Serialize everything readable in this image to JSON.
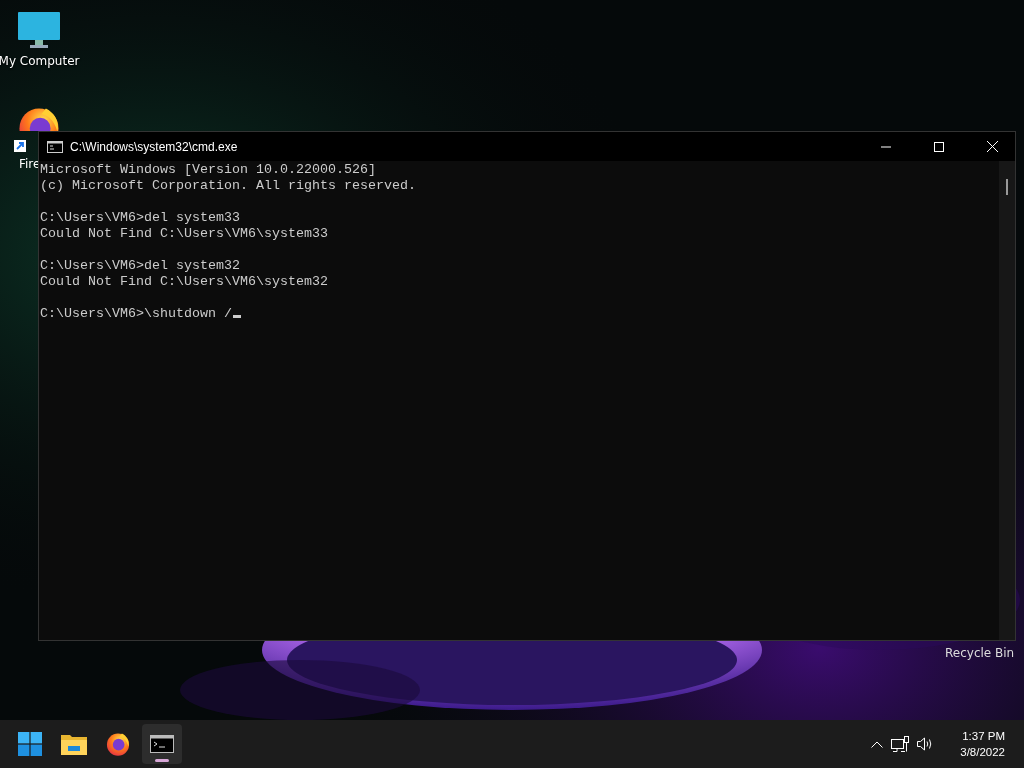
{
  "desktop": {
    "icons": [
      {
        "label": "My Computer",
        "kind": "computer"
      },
      {
        "label": "Fire",
        "kind": "firefox"
      },
      {
        "label": "Recycle Bin",
        "kind": "recycle"
      }
    ]
  },
  "window": {
    "title": "C:\\Windows\\system32\\cmd.exe",
    "console": {
      "blocks": [
        [
          "Microsoft Windows [Version 10.0.22000.526]",
          "(c) Microsoft Corporation. All rights reserved."
        ],
        [
          "C:\\Users\\VM6>del system33",
          "Could Not Find C:\\Users\\VM6\\system33"
        ],
        [
          "C:\\Users\\VM6>del system32",
          "Could Not Find C:\\Users\\VM6\\system32"
        ],
        [
          "C:\\Users\\VM6>\\shutdown /"
        ]
      ],
      "cursor": true
    }
  },
  "taskbar": {
    "apps": [
      {
        "kind": "start",
        "running": false
      },
      {
        "kind": "explorer",
        "running": false
      },
      {
        "kind": "firefox",
        "running": false
      },
      {
        "kind": "terminal",
        "running": true
      }
    ],
    "tray": {
      "time": "1:37 PM",
      "date": "3/8/2022"
    }
  }
}
